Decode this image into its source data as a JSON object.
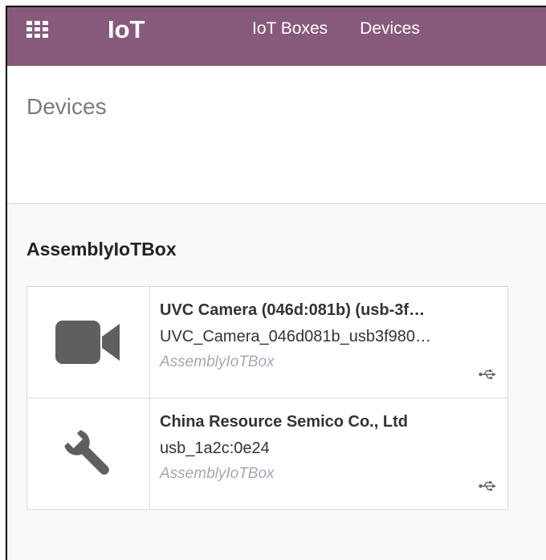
{
  "navbar": {
    "app_title": "IoT",
    "menu": [
      {
        "label": "IoT Boxes"
      },
      {
        "label": "Devices"
      }
    ],
    "color": "#875a7b"
  },
  "breadcrumb": "Devices",
  "group": {
    "title": "AssemblyIoTBox"
  },
  "devices": [
    {
      "name": "UVC Camera (046d:081b) (usb-3f…",
      "identifier": "UVC_Camera_046d081b_usb3f980…",
      "iot_box": "AssemblyIoTBox",
      "icon": "video-camera-icon",
      "connection": "usb-icon"
    },
    {
      "name": "China Resource Semico Co., Ltd",
      "identifier": "usb_1a2c:0e24",
      "iot_box": "AssemblyIoTBox",
      "icon": "wrench-icon",
      "connection": "usb-icon"
    }
  ]
}
